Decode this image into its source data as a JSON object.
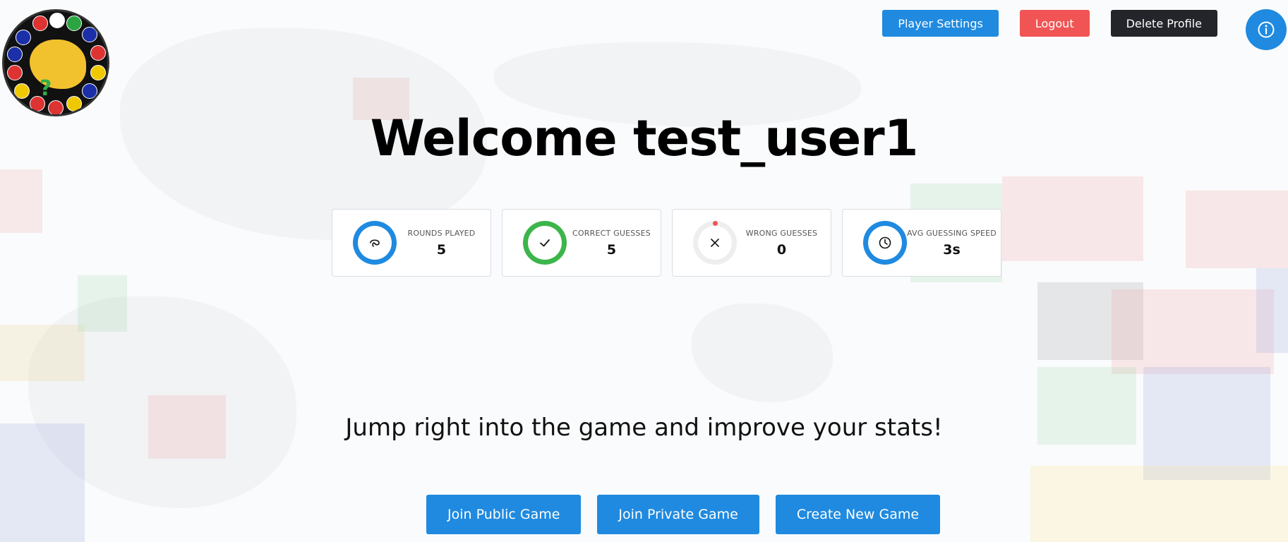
{
  "header": {
    "logo_icon": "flags-globe-logo",
    "player_settings_label": "Player Settings",
    "logout_label": "Logout",
    "delete_profile_label": "Delete Profile",
    "info_icon": "info-icon"
  },
  "colors": {
    "primary": "#1f8ae0",
    "danger": "#f05454",
    "dark": "#23252b",
    "success": "#3cb54a"
  },
  "welcome": {
    "title": "Welcome test_user1"
  },
  "stats": [
    {
      "label": "ROUNDS PLAYED",
      "value": "5",
      "icon": "rounds-loop-icon",
      "ring_color": "#1f8ae0"
    },
    {
      "label": "CORRECT GUESSES",
      "value": "5",
      "icon": "checkmark-icon",
      "ring_color": "#3cb54a"
    },
    {
      "label": "WRONG GUESSES",
      "value": "0",
      "icon": "x-mark-icon",
      "ring_color": "#eeeeee"
    },
    {
      "label": "AVG GUESSING SPEED",
      "value": "3s",
      "icon": "clock-icon",
      "ring_color": "#1f8ae0"
    }
  ],
  "cta": {
    "tagline": "Jump right into the game and improve your stats!",
    "join_public_label": "Join Public Game",
    "join_private_label": "Join Private Game",
    "create_new_label": "Create New Game"
  }
}
